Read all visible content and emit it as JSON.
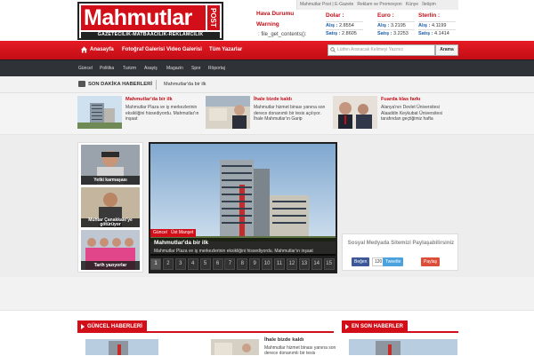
{
  "header": {
    "logo_text": "Mahmutlar",
    "logo_post": "POST",
    "logo_sub": "GAZETECİLİK-MATBAACILIK-REKLAMCILIK",
    "top_links": [
      "Mahmutlar Post",
      "E-Gazete",
      "Reklam ve Promosyon",
      "Künye",
      "İletişim"
    ],
    "weather_title": "Hava Durumu",
    "weather_warning": "Warning",
    "weather_error": ": file_get_contents():",
    "currencies": [
      {
        "name": "Dolar :",
        "buy_label": "Alış :",
        "buy": "2.8554",
        "sell_label": "Satış :",
        "sell": "2.8605"
      },
      {
        "name": "Euro :",
        "buy_label": "Alış :",
        "buy": "3.2195",
        "sell_label": "Satış :",
        "sell": "3.2253"
      },
      {
        "name": "Sterlin :",
        "buy_label": "Alış :",
        "buy": "4.1199",
        "sell_label": "Satış :",
        "sell": "4.1414"
      }
    ]
  },
  "nav": {
    "items": [
      "Anasayfa",
      "Fotoğraf Galerisi",
      "Video Galerisi",
      "Tüm Yazarlar"
    ],
    "search_placeholder": "Lütfen Aranacak Kelimeyi Yazınız",
    "search_button": "Arama"
  },
  "subnav": {
    "items": [
      "Güncel",
      "Politika",
      "Turizm",
      "Asayiş",
      "Magazin",
      "Spor",
      "Röportaj"
    ]
  },
  "breaking": {
    "label": "SON DAKİKA HABERLERİ",
    "text": "Mahmutlar'da bir ilk"
  },
  "strip_news": [
    {
      "title": "Mahmutlar'da bir ilk",
      "desc": "Mahmutlar Plaza ve iş merkezlerinin eksikliğini hissediyordu. Mahmutlar'ın inşaat"
    },
    {
      "title": "İhale bizde kaldı",
      "desc": "Mahmutlar hizmet binası yanına son derece donanımlı bir tesis açılıyor. İhale Mahmutlar'ın Garip"
    },
    {
      "title": "Fuarda klas farkı",
      "desc": "Alanya'nın Devlet Üniversitesi Alaaddin Keykubat Üniversitesi tarafından geçtiğimiz hafta"
    }
  ],
  "left_photos": [
    {
      "caption": "Yetki karmaşası"
    },
    {
      "caption": "Muhtar Çanakkale'ye götürüyor"
    },
    {
      "caption": "Tarih yazıyorlar"
    }
  ],
  "slider": {
    "badges": [
      "Güncel",
      "Üst Manşet"
    ],
    "title": "Mahmutlar'da bir ilk",
    "desc": "Mahmutlar Plaza ve iş merkezlerinin eksikliğini hissediyordu. Mahmutlar'ın inşaat",
    "pages": [
      "1",
      "2",
      "3",
      "4",
      "5",
      "6",
      "7",
      "8",
      "9",
      "10",
      "11",
      "12",
      "13",
      "14",
      "15"
    ],
    "active_page": "1"
  },
  "social_box": {
    "title": "Sosyal Medyada Sitemizi Paylaşabilirsiniz",
    "facebook": "Beğen",
    "facebook_count": "120",
    "twitter": "Tweetle",
    "google": "Paylaş"
  },
  "sections": {
    "guncel": "GÜNCEL HABERLERİ",
    "en_son": "EN SON HABERLER",
    "lower_title": "İhale bizde kaldı",
    "lower_desc": "Mahmutlar hizmet binası yanına son derece donanımlı bir tesis"
  },
  "colors": {
    "brand_red": "#d20f19",
    "dark_nav": "#2f3338",
    "link_blue": "#1c5fa8"
  }
}
